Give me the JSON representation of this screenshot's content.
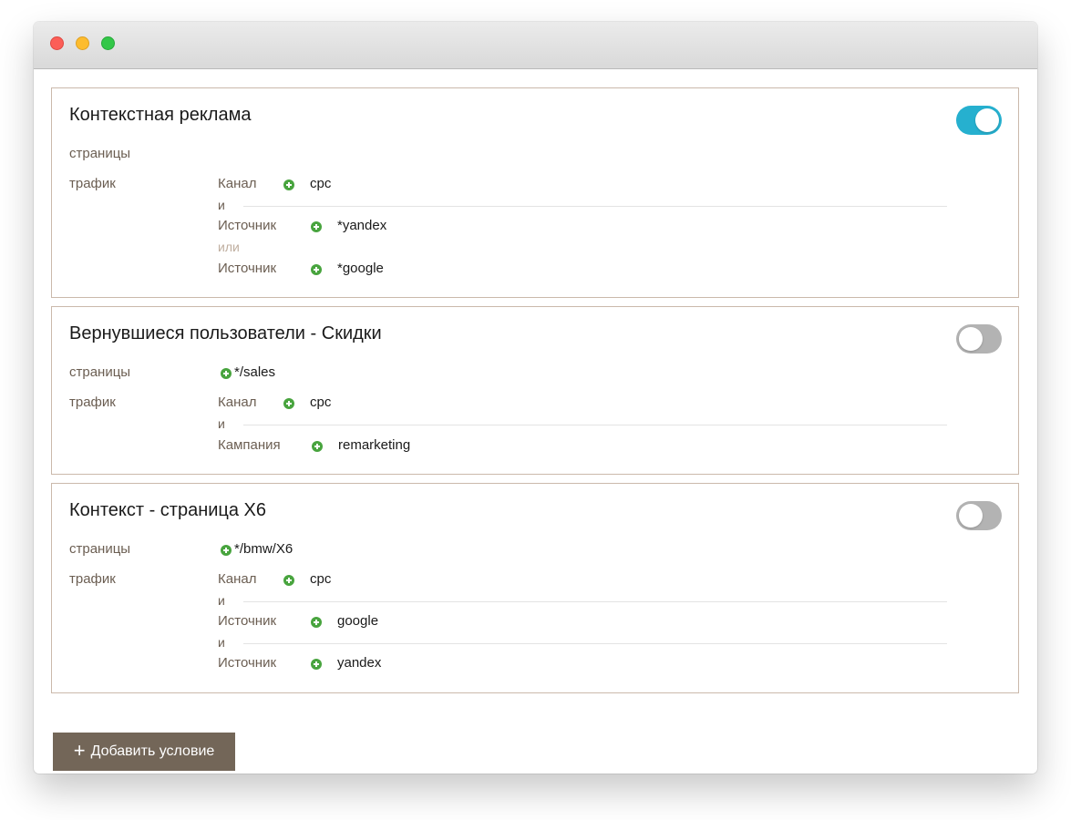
{
  "rules": [
    {
      "title": "Контекстная реклама",
      "enabled": true,
      "pages_label": "страницы",
      "pages_value": "",
      "traffic_label": "трафик",
      "conditions": [
        {
          "label": "Канал",
          "value": "cpc"
        },
        {
          "conj": "и",
          "label": "Источник",
          "value": "*yandex"
        },
        {
          "conj": "или",
          "label": "Источник",
          "value": "*google"
        }
      ]
    },
    {
      "title": "Вернувшиеся пользователи - Скидки",
      "enabled": false,
      "pages_label": "страницы",
      "pages_value": "*/sales",
      "traffic_label": "трафик",
      "conditions": [
        {
          "label": "Канал",
          "value": "cpc"
        },
        {
          "conj": "и",
          "label": "Кампания",
          "value": "remarketing"
        }
      ]
    },
    {
      "title": "Контекст - страница X6",
      "enabled": false,
      "pages_label": "страницы",
      "pages_value": "*/bmw/X6",
      "traffic_label": "трафик",
      "conditions": [
        {
          "label": "Канал",
          "value": "cpc"
        },
        {
          "conj": "и",
          "label": "Источник",
          "value": "google"
        },
        {
          "conj": "и",
          "label": "Источник",
          "value": "yandex"
        }
      ]
    }
  ],
  "add_button": {
    "icon": "plus-icon",
    "label": "Добавить условие"
  },
  "colors": {
    "toggle_on": "#26b0cf",
    "toggle_off": "#b3b3b3",
    "add_icon": "#48a43e",
    "button_bg": "#736658",
    "card_border": "#cbb9ab"
  }
}
